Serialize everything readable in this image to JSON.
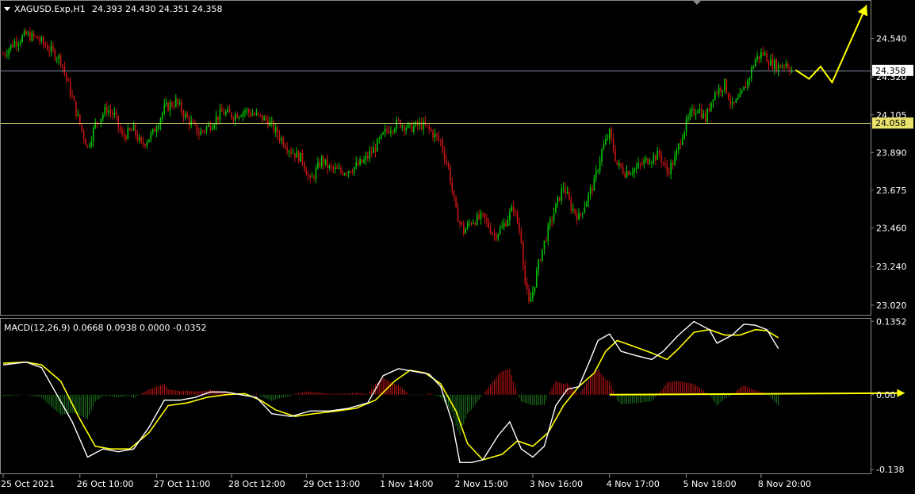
{
  "header": {
    "symbol_timeframe": "XAGUSD.Exp,H1",
    "ohlc": "24.393 24.430 24.351 24.358"
  },
  "macd_header": {
    "label": "MACD(12,26,9) 0.0668 0.0938 0.0000 -0.0352"
  },
  "colors": {
    "background": "#000000",
    "bull_candle": "#00c800",
    "bear_candle": "#c81414",
    "bid_line": "#7f8ea0",
    "level_line": "#e8e26a",
    "annotation": "#ffff00",
    "macd_main": "#ffffff",
    "macd_signal": "#ffff00",
    "hist_positive": "#c81414",
    "hist_negative": "#1f7a1f",
    "axis_text": "#ffffff"
  },
  "chart_data": [
    {
      "type": "candlestick",
      "title": "XAGUSD.Exp,H1",
      "x_tick_labels": [
        "25 Oct 2021",
        "26 Oct 10:00",
        "27 Oct 11:00",
        "28 Oct 12:00",
        "29 Oct 13:00",
        "1 Nov 14:00",
        "2 Nov 15:00",
        "3 Nov 16:00",
        "4 Nov 17:00",
        "5 Nov 18:00",
        "8 Nov 20:00"
      ],
      "y_tick_labels": [
        "24.540",
        "24.320",
        "24.105",
        "23.890",
        "23.675",
        "23.460",
        "23.240",
        "23.020"
      ],
      "ylim": [
        22.965,
        24.755
      ],
      "price_path": [
        [
          0,
          24.45
        ],
        [
          6,
          24.52
        ],
        [
          12,
          24.56
        ],
        [
          18,
          24.54
        ],
        [
          24,
          24.48
        ],
        [
          30,
          24.42
        ],
        [
          36,
          24.2
        ],
        [
          40,
          24.05
        ],
        [
          44,
          23.92
        ],
        [
          48,
          24.05
        ],
        [
          54,
          24.14
        ],
        [
          58,
          24.1
        ],
        [
          62,
          23.98
        ],
        [
          68,
          24.02
        ],
        [
          72,
          23.93
        ],
        [
          78,
          24.0
        ],
        [
          84,
          24.14
        ],
        [
          90,
          24.18
        ],
        [
          96,
          24.08
        ],
        [
          102,
          24.0
        ],
        [
          108,
          24.05
        ],
        [
          114,
          24.12
        ],
        [
          120,
          24.1
        ],
        [
          126,
          24.13
        ],
        [
          132,
          24.1
        ],
        [
          138,
          24.07
        ],
        [
          144,
          23.98
        ],
        [
          150,
          23.9
        ],
        [
          156,
          23.85
        ],
        [
          160,
          23.72
        ],
        [
          166,
          23.85
        ],
        [
          170,
          23.8
        ],
        [
          176,
          23.78
        ],
        [
          182,
          23.8
        ],
        [
          188,
          23.84
        ],
        [
          194,
          23.92
        ],
        [
          200,
          24.02
        ],
        [
          206,
          24.06
        ],
        [
          212,
          24.03
        ],
        [
          218,
          24.05
        ],
        [
          222,
          24.02
        ],
        [
          228,
          23.95
        ],
        [
          232,
          23.8
        ],
        [
          236,
          23.55
        ],
        [
          240,
          23.44
        ],
        [
          244,
          23.5
        ],
        [
          250,
          23.52
        ],
        [
          256,
          23.42
        ],
        [
          260,
          23.46
        ],
        [
          266,
          23.58
        ],
        [
          270,
          23.4
        ],
        [
          272,
          23.15
        ],
        [
          274,
          23.02
        ],
        [
          276,
          23.1
        ],
        [
          280,
          23.3
        ],
        [
          284,
          23.45
        ],
        [
          288,
          23.58
        ],
        [
          292,
          23.7
        ],
        [
          296,
          23.58
        ],
        [
          300,
          23.52
        ],
        [
          304,
          23.62
        ],
        [
          308,
          23.72
        ],
        [
          312,
          23.9
        ],
        [
          316,
          24.0
        ],
        [
          320,
          23.82
        ],
        [
          324,
          23.78
        ],
        [
          330,
          23.8
        ],
        [
          336,
          23.85
        ],
        [
          342,
          23.88
        ],
        [
          346,
          23.78
        ],
        [
          350,
          23.85
        ],
        [
          354,
          24.0
        ],
        [
          358,
          24.1
        ],
        [
          362,
          24.15
        ],
        [
          366,
          24.08
        ],
        [
          370,
          24.22
        ],
        [
          376,
          24.28
        ],
        [
          380,
          24.15
        ],
        [
          384,
          24.2
        ],
        [
          388,
          24.3
        ],
        [
          392,
          24.42
        ],
        [
          396,
          24.46
        ],
        [
          400,
          24.4
        ],
        [
          404,
          24.38
        ],
        [
          408,
          24.4
        ],
        [
          411,
          24.36
        ]
      ],
      "horizontal_lines": [
        {
          "name": "bid",
          "value": 24.358,
          "label": "24.358"
        },
        {
          "name": "level",
          "value": 24.058,
          "label": "24.058"
        }
      ],
      "annotations": [
        {
          "type": "polyline_arrow",
          "points": [
            [
              413,
              24.36
            ],
            [
              420,
              24.31
            ],
            [
              426,
              24.38
            ],
            [
              432,
              24.29
            ],
            [
              450,
              24.73
            ]
          ]
        }
      ]
    },
    {
      "type": "macd",
      "title": "MACD(12,26,9)",
      "values_shown": [
        0.0668,
        0.0938,
        0.0,
        -0.0352
      ],
      "y_tick_labels": [
        "0.1352",
        "0.00",
        "-0.138"
      ],
      "ylim": [
        -0.145,
        0.14
      ],
      "main_path": [
        [
          0,
          0.055
        ],
        [
          12,
          0.06
        ],
        [
          20,
          0.05
        ],
        [
          28,
          0.0
        ],
        [
          36,
          -0.05
        ],
        [
          44,
          -0.115
        ],
        [
          52,
          -0.1
        ],
        [
          60,
          -0.105
        ],
        [
          68,
          -0.1
        ],
        [
          76,
          -0.06
        ],
        [
          84,
          -0.01
        ],
        [
          92,
          -0.01
        ],
        [
          100,
          -0.005
        ],
        [
          108,
          0.005
        ],
        [
          116,
          0.005
        ],
        [
          124,
          0.0
        ],
        [
          132,
          -0.005
        ],
        [
          140,
          -0.035
        ],
        [
          150,
          -0.04
        ],
        [
          160,
          -0.03
        ],
        [
          170,
          -0.03
        ],
        [
          180,
          -0.025
        ],
        [
          190,
          -0.015
        ],
        [
          198,
          0.035
        ],
        [
          206,
          0.048
        ],
        [
          214,
          0.043
        ],
        [
          222,
          0.038
        ],
        [
          228,
          0.015
        ],
        [
          234,
          -0.05
        ],
        [
          238,
          -0.125
        ],
        [
          244,
          -0.125
        ],
        [
          250,
          -0.12
        ],
        [
          258,
          -0.075
        ],
        [
          264,
          -0.05
        ],
        [
          270,
          -0.1
        ],
        [
          276,
          -0.115
        ],
        [
          282,
          -0.095
        ],
        [
          288,
          -0.02
        ],
        [
          294,
          0.01
        ],
        [
          300,
          0.015
        ],
        [
          306,
          0.065
        ],
        [
          310,
          0.1
        ],
        [
          316,
          0.112
        ],
        [
          322,
          0.08
        ],
        [
          330,
          0.072
        ],
        [
          338,
          0.065
        ],
        [
          344,
          0.08
        ],
        [
          352,
          0.11
        ],
        [
          360,
          0.135
        ],
        [
          368,
          0.12
        ],
        [
          372,
          0.095
        ],
        [
          380,
          0.11
        ],
        [
          386,
          0.13
        ],
        [
          392,
          0.128
        ],
        [
          398,
          0.12
        ],
        [
          404,
          0.085
        ]
      ],
      "signal_path": [
        [
          0,
          0.058
        ],
        [
          12,
          0.06
        ],
        [
          20,
          0.055
        ],
        [
          30,
          0.025
        ],
        [
          40,
          -0.045
        ],
        [
          48,
          -0.095
        ],
        [
          56,
          -0.1
        ],
        [
          66,
          -0.1
        ],
        [
          76,
          -0.07
        ],
        [
          86,
          -0.02
        ],
        [
          96,
          -0.015
        ],
        [
          106,
          -0.005
        ],
        [
          116,
          0.0
        ],
        [
          126,
          0.002
        ],
        [
          134,
          -0.01
        ],
        [
          142,
          -0.028
        ],
        [
          152,
          -0.04
        ],
        [
          162,
          -0.035
        ],
        [
          174,
          -0.03
        ],
        [
          184,
          -0.025
        ],
        [
          194,
          -0.01
        ],
        [
          204,
          0.025
        ],
        [
          212,
          0.045
        ],
        [
          220,
          0.04
        ],
        [
          228,
          0.02
        ],
        [
          236,
          -0.03
        ],
        [
          242,
          -0.09
        ],
        [
          250,
          -0.12
        ],
        [
          260,
          -0.11
        ],
        [
          268,
          -0.085
        ],
        [
          276,
          -0.095
        ],
        [
          284,
          -0.07
        ],
        [
          292,
          -0.02
        ],
        [
          300,
          0.015
        ],
        [
          308,
          0.04
        ],
        [
          314,
          0.08
        ],
        [
          320,
          0.1
        ],
        [
          328,
          0.09
        ],
        [
          338,
          0.077
        ],
        [
          346,
          0.065
        ],
        [
          352,
          0.085
        ],
        [
          360,
          0.115
        ],
        [
          368,
          0.12
        ],
        [
          376,
          0.11
        ],
        [
          384,
          0.11
        ],
        [
          392,
          0.12
        ],
        [
          398,
          0.118
        ],
        [
          404,
          0.105
        ]
      ],
      "annotations": [
        {
          "type": "arrow",
          "from": [
            316,
            0.0
          ],
          "to": [
            470,
            0.003
          ]
        }
      ]
    }
  ]
}
